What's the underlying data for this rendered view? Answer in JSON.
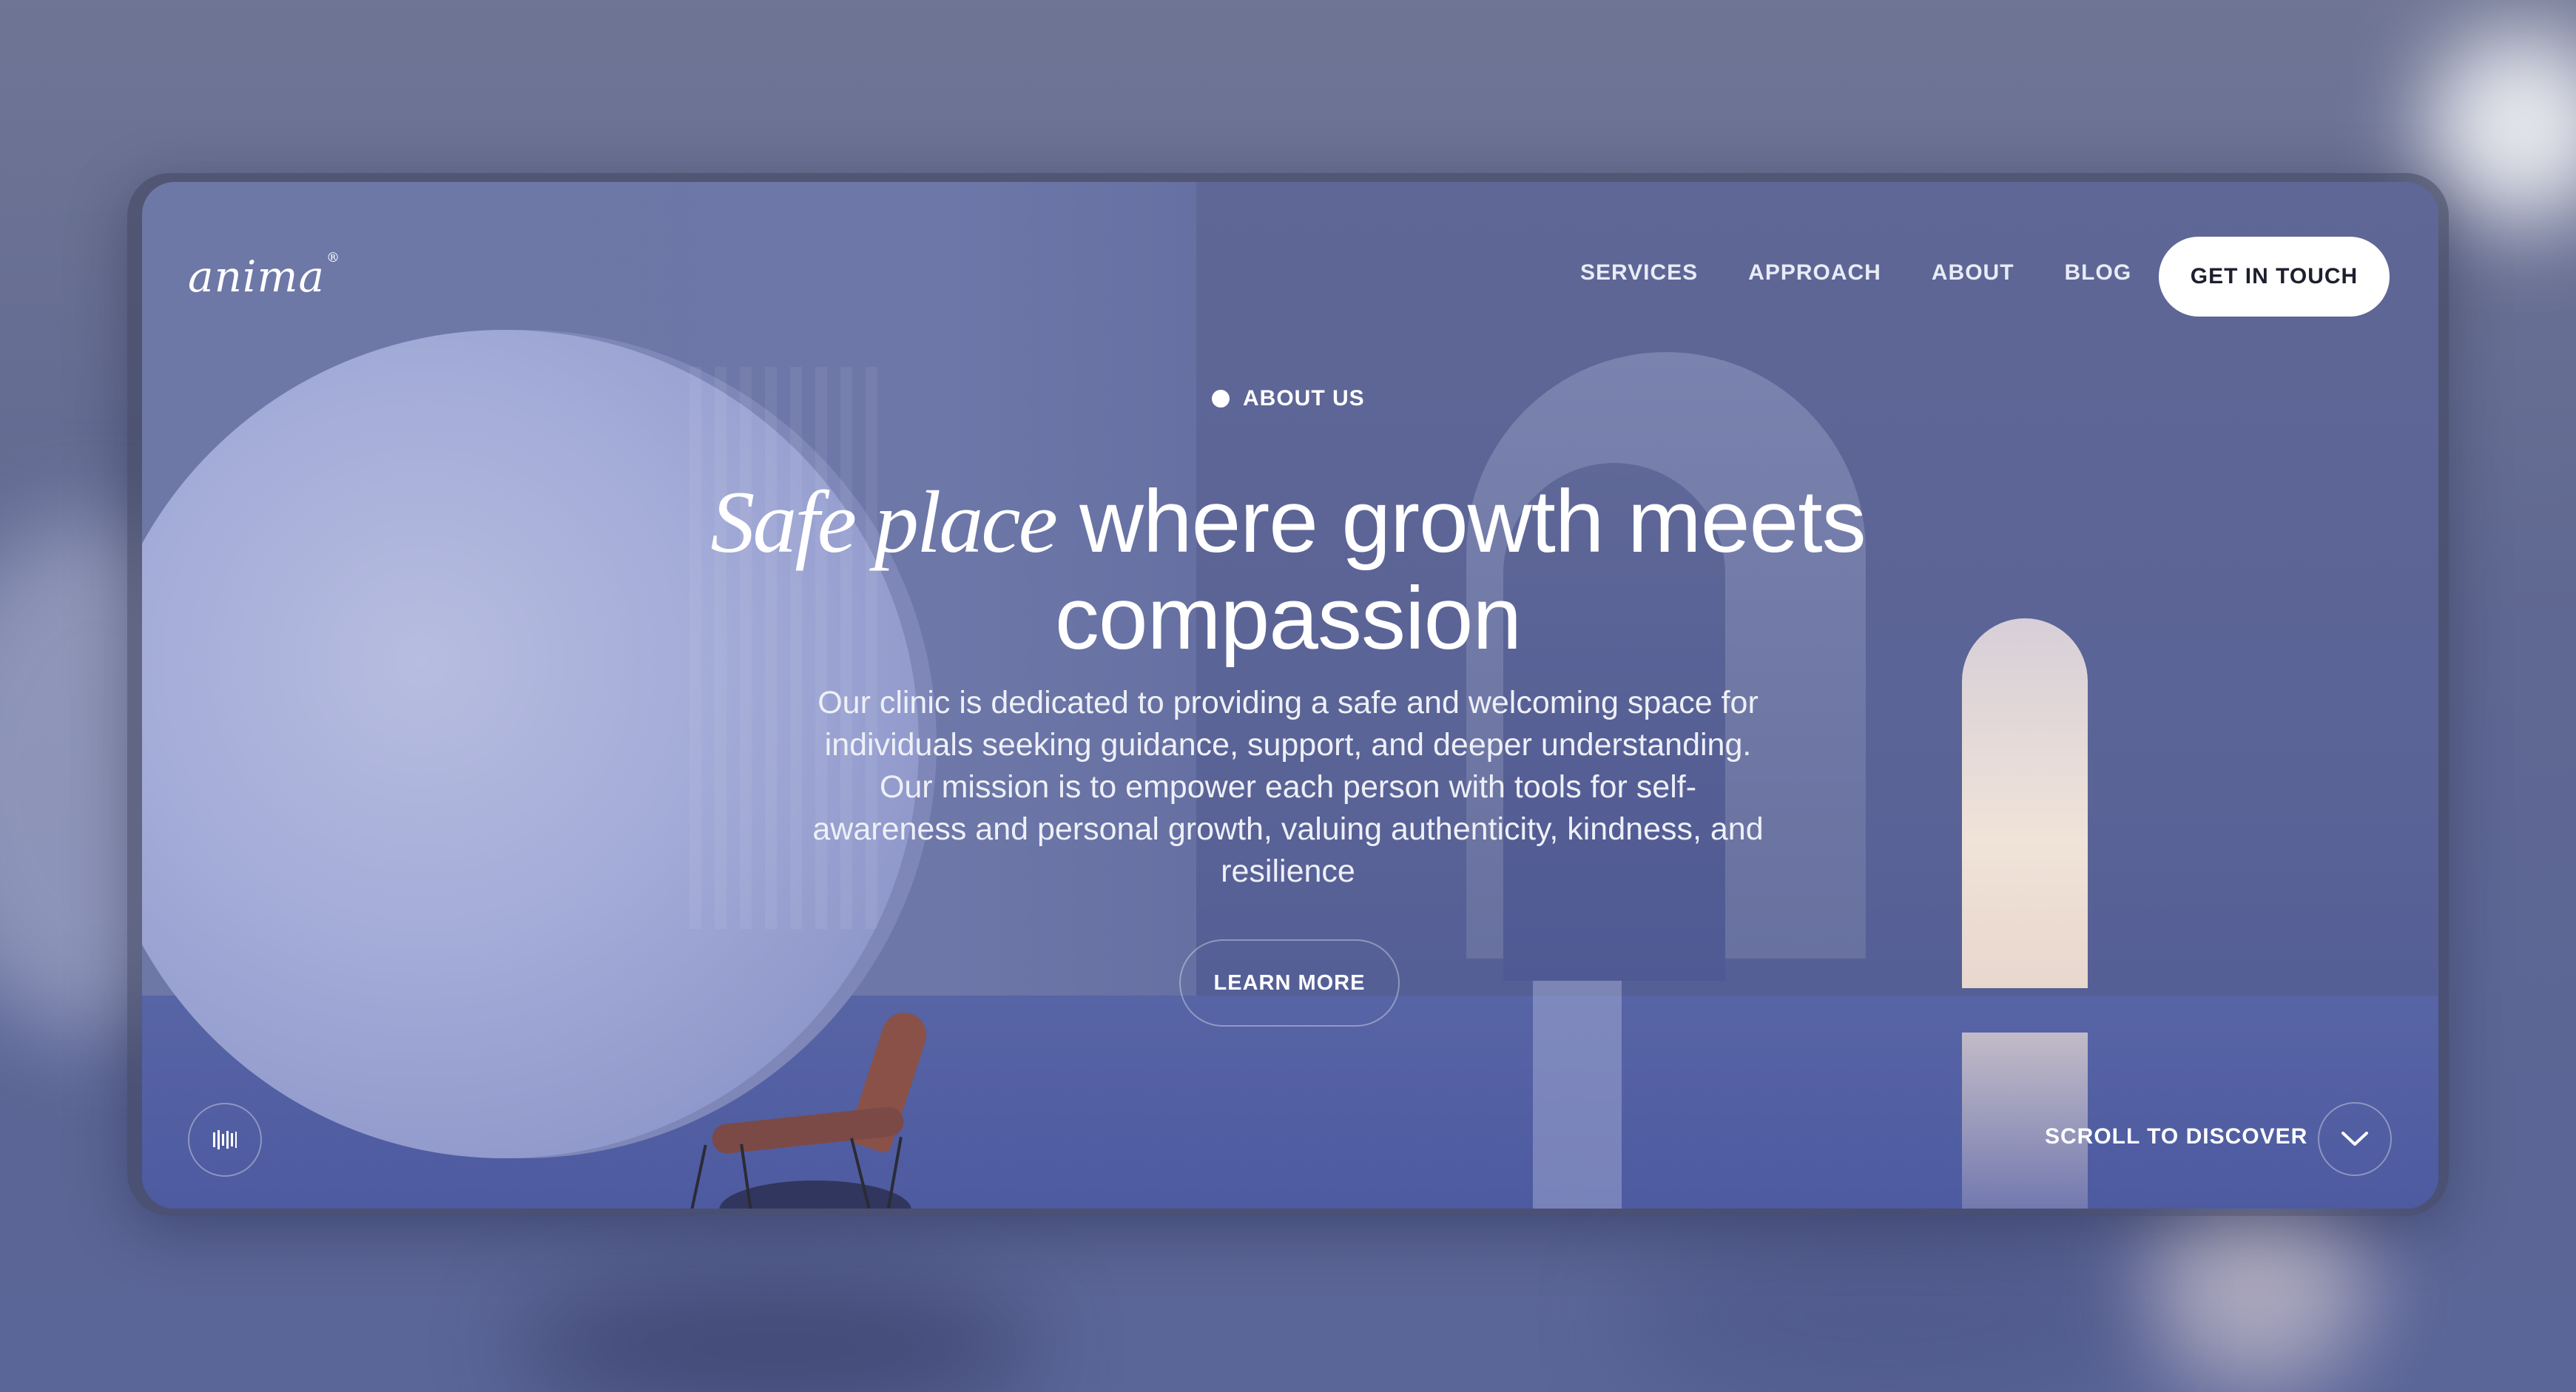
{
  "brand": {
    "logo_text": "anima",
    "logo_mark": "®"
  },
  "nav": {
    "items": [
      {
        "label": "SERVICES"
      },
      {
        "label": "APPROACH"
      },
      {
        "label": "ABOUT"
      },
      {
        "label": "BLOG"
      }
    ],
    "cta_label": "GET IN TOUCH"
  },
  "hero": {
    "eyebrow": "ABOUT US",
    "headline_accent": "Safe place",
    "headline_rest": " where growth meets",
    "headline_line2": "compassion",
    "description": "Our clinic is dedicated to providing a safe and welcoming space for individuals seeking guidance, support, and deeper understanding. Our mission is to empower each person with tools for self-awareness and personal growth, valuing authenticity, kindness, and resilience",
    "button_label": "LEARN MORE"
  },
  "footer_controls": {
    "sound_icon": "sound-bars-icon",
    "scroll_label": "SCROLL TO DISCOVER",
    "scroll_icon": "chevron-down-icon"
  },
  "colors": {
    "hero_tint": "#6d77a8",
    "cta_bg": "#ffffff",
    "cta_text": "#1d1f2e",
    "text": "#ffffff"
  }
}
